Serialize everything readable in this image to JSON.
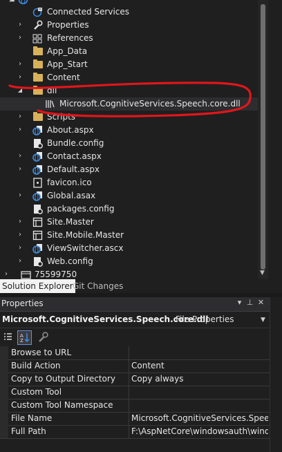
{
  "tree": {
    "items": [
      {
        "label": "Connected Services",
        "icon": "connected-services-icon"
      },
      {
        "label": "Properties",
        "icon": "wrench-icon"
      },
      {
        "label": "References",
        "icon": "references-icon"
      },
      {
        "label": "App_Data",
        "icon": "folder-icon"
      },
      {
        "label": "App_Start",
        "icon": "folder-icon"
      },
      {
        "label": "Content",
        "icon": "folder-icon"
      },
      {
        "label": "dll",
        "icon": "folder-open-icon"
      },
      {
        "label": "Microsoft.CognitiveServices.Speech.core.dll",
        "icon": "dll-file-icon"
      },
      {
        "label": "Scripts",
        "icon": "folder-icon"
      },
      {
        "label": "About.aspx",
        "icon": "aspx-globe-icon"
      },
      {
        "label": "Bundle.config",
        "icon": "config-file-icon"
      },
      {
        "label": "Contact.aspx",
        "icon": "aspx-globe-icon"
      },
      {
        "label": "Default.aspx",
        "icon": "aspx-globe-icon"
      },
      {
        "label": "favicon.ico",
        "icon": "image-file-icon"
      },
      {
        "label": "Global.asax",
        "icon": "asax-globe-icon"
      },
      {
        "label": "packages.config",
        "icon": "config-file-icon"
      },
      {
        "label": "Site.Master",
        "icon": "master-page-icon"
      },
      {
        "label": "Site.Mobile.Master",
        "icon": "master-page-icon"
      },
      {
        "label": "ViewSwitcher.ascx",
        "icon": "user-control-icon"
      },
      {
        "label": "Web.config",
        "icon": "config-file-icon"
      },
      {
        "label": "75599750",
        "icon": "project-icon"
      }
    ]
  },
  "tabs": {
    "solution_explorer": "Solution Explorer",
    "git_changes": "Git Changes"
  },
  "properties": {
    "title": "Properties",
    "header_buttons": {
      "dropdown": "▾",
      "pin": "⊥",
      "close": "✕"
    },
    "object_name": "Microsoft.CognitiveServices.Speech.core.dll",
    "object_type": "File Properties",
    "toolbar": [
      "categorized-icon",
      "alphabetical-icon",
      "property-pages-icon"
    ],
    "rows": [
      {
        "name": "Browse to URL",
        "value": ""
      },
      {
        "name": "Build Action",
        "value": "Content"
      },
      {
        "name": "Copy to Output Directory",
        "value": "Copy always"
      },
      {
        "name": "Custom Tool",
        "value": ""
      },
      {
        "name": "Custom Tool Namespace",
        "value": ""
      },
      {
        "name": "File Name",
        "value": "Microsoft.CognitiveServices.Speech.c"
      },
      {
        "name": "Full Path",
        "value": "F:\\AspNetCore\\windowsauth\\window"
      }
    ]
  },
  "colors": {
    "background": "#1f1f1f",
    "annotation_red": "#e0161b",
    "folder": "#d8b25a",
    "globe": "#3c8ee8"
  }
}
